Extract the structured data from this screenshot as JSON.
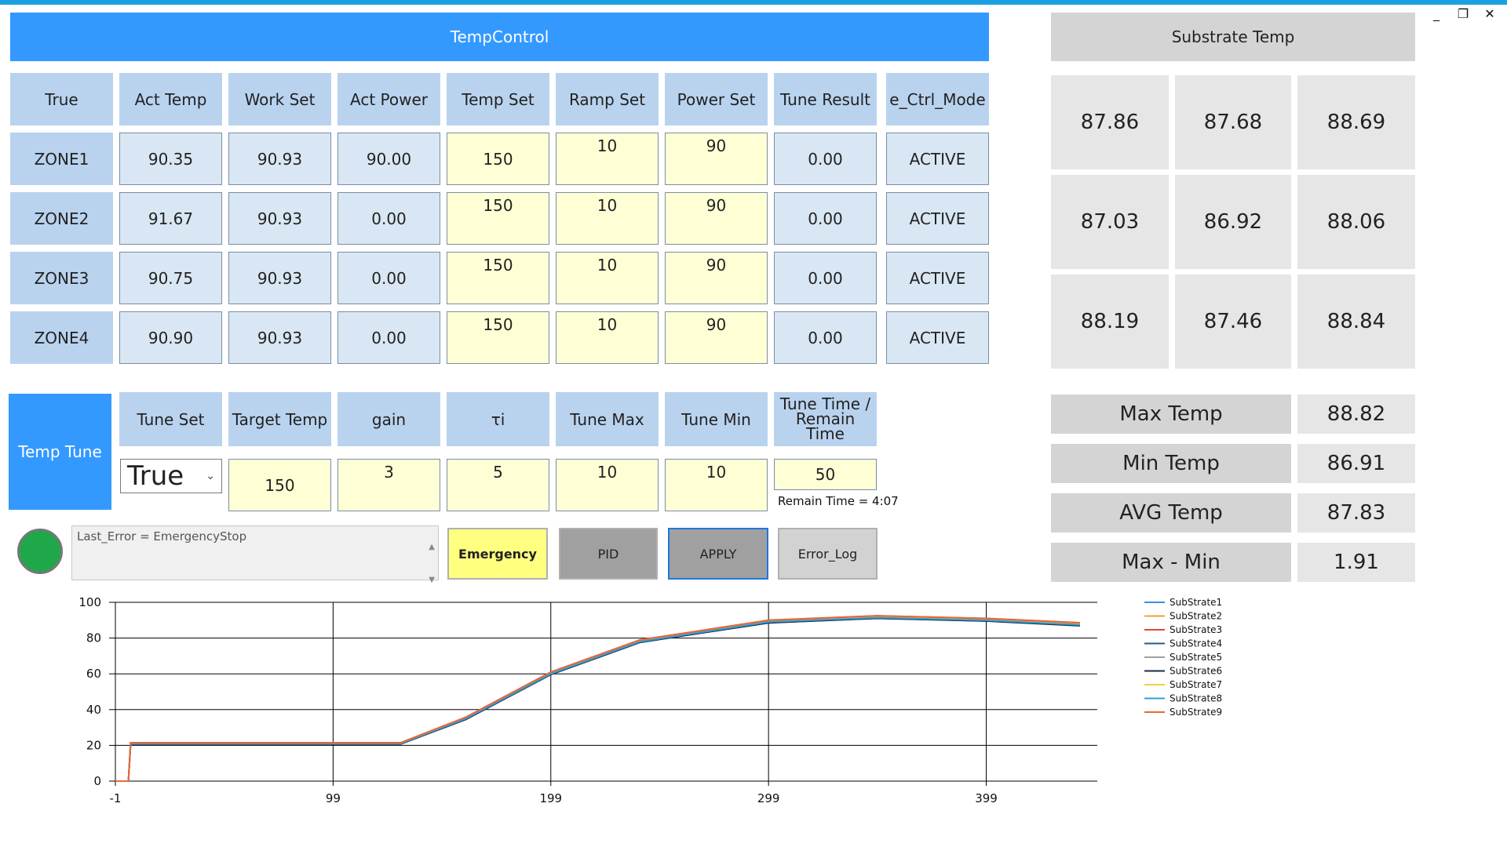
{
  "window": {
    "controls": [
      "_",
      "❐",
      "✕"
    ]
  },
  "main": {
    "title": "TempControl"
  },
  "zone_table": {
    "headers": [
      "True",
      "Act Temp",
      "Work Set",
      "Act Power",
      "Temp Set",
      "Ramp Set",
      "Power Set",
      "Tune Result",
      "e_Ctrl_Mode"
    ],
    "rows": [
      [
        "ZONE1",
        "90.35",
        "90.93",
        "90.00",
        "150",
        "10",
        "90",
        "0.00",
        "ACTIVE"
      ],
      [
        "ZONE2",
        "91.67",
        "90.93",
        "0.00",
        "150",
        "10",
        "90",
        "0.00",
        "ACTIVE"
      ],
      [
        "ZONE3",
        "90.75",
        "90.93",
        "0.00",
        "150",
        "10",
        "90",
        "0.00",
        "ACTIVE"
      ],
      [
        "ZONE4",
        "90.90",
        "90.93",
        "0.00",
        "150",
        "10",
        "90",
        "0.00",
        "ACTIVE"
      ]
    ]
  },
  "temp_tune": {
    "label": "Temp Tune",
    "headers": [
      "Tune Set",
      "Target Temp",
      "gain",
      "τi",
      "Tune Max",
      "Tune Min",
      "Tune Time / Remain Time"
    ],
    "tune_set": "True",
    "values": [
      "150",
      "3",
      "5",
      "10",
      "10",
      "50"
    ],
    "remain_time": "Remain Time = 4:07"
  },
  "status": {
    "led_color": "#1fa84a",
    "last_error": "Last_Error = EmergencyStop"
  },
  "buttons": {
    "emergency": "Emergency",
    "pid": "PID",
    "apply": "APPLY",
    "error_log": "Error_Log"
  },
  "substrate": {
    "title": "Substrate Temp",
    "grid": [
      "87.86",
      "87.68",
      "88.69",
      "87.03",
      "86.92",
      "88.06",
      "88.19",
      "87.46",
      "88.84"
    ],
    "stats": [
      {
        "label": "Max Temp",
        "value": "88.82"
      },
      {
        "label": "Min Temp",
        "value": "86.91"
      },
      {
        "label": "AVG Temp",
        "value": "87.83"
      },
      {
        "label": "Max - Min",
        "value": "1.91"
      }
    ]
  },
  "colors": {
    "accent": "#3399ff",
    "header": "#b9d3ef",
    "display": "#d9e7f4",
    "input": "#ffffd6",
    "emergency": "#ffff80"
  },
  "chart_data": {
    "type": "line",
    "xlim": [
      -1,
      450
    ],
    "ylim": [
      0,
      100
    ],
    "x_ticks": [
      "-1",
      "99",
      "199",
      "299",
      "399"
    ],
    "y_ticks": [
      "0",
      "20",
      "40",
      "60",
      "80",
      "100"
    ],
    "grid": true,
    "legend_position": "right",
    "series": [
      {
        "name": "SubStrate1",
        "color": "#3c8ce6",
        "points": [
          [
            -1,
            0
          ],
          [
            5,
            0
          ],
          [
            6,
            21
          ],
          [
            130,
            21
          ],
          [
            160,
            35
          ],
          [
            199,
            60
          ],
          [
            240,
            78
          ],
          [
            299,
            89
          ],
          [
            349,
            91.5
          ],
          [
            399,
            90
          ],
          [
            442,
            87.5
          ]
        ]
      },
      {
        "name": "SubStrate2",
        "color": "#f0a030",
        "points": [
          [
            -1,
            0
          ],
          [
            5,
            0
          ],
          [
            6,
            21.3
          ],
          [
            130,
            21.3
          ],
          [
            160,
            35.6
          ],
          [
            199,
            60.8
          ],
          [
            240,
            78.8
          ],
          [
            299,
            89.8
          ],
          [
            349,
            92.3
          ],
          [
            399,
            90.8
          ],
          [
            442,
            88.4
          ]
        ]
      },
      {
        "name": "SubStrate3",
        "color": "#e2472a",
        "points": [
          [
            -1,
            0
          ],
          [
            5,
            0
          ],
          [
            6,
            21.5
          ],
          [
            130,
            21.5
          ],
          [
            160,
            35.8
          ],
          [
            199,
            61
          ],
          [
            240,
            79
          ],
          [
            299,
            90
          ],
          [
            349,
            92.5
          ],
          [
            399,
            91
          ],
          [
            442,
            88.6
          ]
        ]
      },
      {
        "name": "SubStrate4",
        "color": "#1f5f8b",
        "points": [
          [
            -1,
            0
          ],
          [
            5,
            0
          ],
          [
            6,
            20.8
          ],
          [
            130,
            20.8
          ],
          [
            160,
            34.6
          ],
          [
            199,
            59.7
          ],
          [
            240,
            77.7
          ],
          [
            299,
            88.6
          ],
          [
            349,
            91.1
          ],
          [
            399,
            89.6
          ],
          [
            442,
            87
          ]
        ]
      },
      {
        "name": "SubStrate5",
        "color": "#a0a0a0",
        "points": [
          [
            -1,
            0
          ],
          [
            5,
            0
          ],
          [
            6,
            20.9
          ],
          [
            130,
            20.9
          ],
          [
            160,
            34.8
          ],
          [
            199,
            59.9
          ],
          [
            240,
            77.9
          ],
          [
            299,
            88.8
          ],
          [
            349,
            91.3
          ],
          [
            399,
            89.8
          ],
          [
            442,
            87.2
          ]
        ]
      },
      {
        "name": "SubStrate6",
        "color": "#1a2a44",
        "points": [
          [
            -1,
            0
          ],
          [
            5,
            0
          ],
          [
            6,
            20.7
          ],
          [
            130,
            20.7
          ],
          [
            160,
            34.5
          ],
          [
            199,
            59.6
          ],
          [
            240,
            77.6
          ],
          [
            299,
            88.5
          ],
          [
            349,
            91
          ],
          [
            399,
            89.5
          ],
          [
            442,
            86.9
          ]
        ]
      },
      {
        "name": "SubStrate7",
        "color": "#f0d040",
        "points": [
          [
            -1,
            0
          ],
          [
            5,
            0
          ],
          [
            6,
            21.1
          ],
          [
            130,
            21.1
          ],
          [
            160,
            35.2
          ],
          [
            199,
            60.3
          ],
          [
            240,
            78.3
          ],
          [
            299,
            89.3
          ],
          [
            349,
            91.8
          ],
          [
            399,
            90.3
          ],
          [
            442,
            87.8
          ]
        ]
      },
      {
        "name": "SubStrate8",
        "color": "#2aa0d8",
        "points": [
          [
            -1,
            0
          ],
          [
            5,
            0
          ],
          [
            6,
            20.9
          ],
          [
            130,
            20.9
          ],
          [
            160,
            34.9
          ],
          [
            199,
            60
          ],
          [
            240,
            78
          ],
          [
            299,
            89
          ],
          [
            349,
            91.4
          ],
          [
            399,
            89.9
          ],
          [
            442,
            87.4
          ]
        ]
      },
      {
        "name": "SubStrate9",
        "color": "#e8683a",
        "points": [
          [
            -1,
            0
          ],
          [
            5,
            0
          ],
          [
            6,
            21.4
          ],
          [
            130,
            21.4
          ],
          [
            160,
            35.7
          ],
          [
            199,
            60.9
          ],
          [
            240,
            78.9
          ],
          [
            299,
            89.9
          ],
          [
            349,
            92.4
          ],
          [
            399,
            90.9
          ],
          [
            442,
            88.5
          ]
        ]
      }
    ]
  }
}
